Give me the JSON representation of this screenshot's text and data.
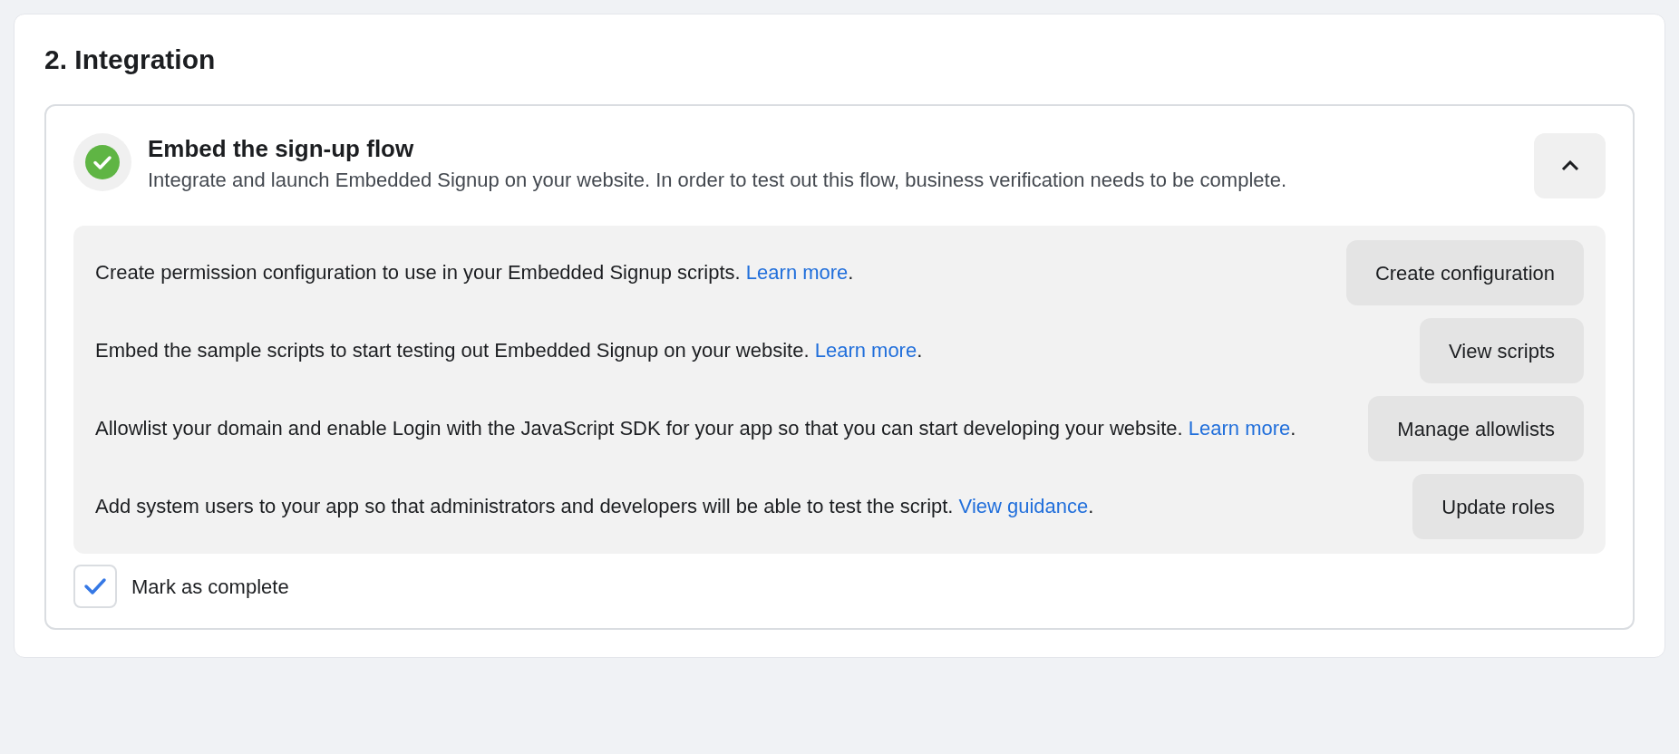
{
  "section": {
    "title": "2. Integration"
  },
  "step": {
    "title": "Embed the sign-up flow",
    "description": "Integrate and launch Embedded Signup on your website. In order to test out this flow, business verification needs to be complete.",
    "completed": true,
    "expanded": true,
    "tasks": [
      {
        "text": "Create permission configuration to use in your Embedded Signup scripts.",
        "link": "Learn more",
        "after": ".",
        "button": "Create configuration"
      },
      {
        "text": "Embed the sample scripts to start testing out Embedded Signup on your website.",
        "link": "Learn more",
        "after": ".",
        "button": "View scripts"
      },
      {
        "text": "Allowlist your domain and enable Login with the JavaScript SDK for your app so that you can start developing your website.",
        "link": "Learn more",
        "after": ".",
        "button": "Manage allowlists"
      },
      {
        "text": "Add system users to your app so that administrators and developers will be able to test the script.",
        "link": "View guidance",
        "after": ".",
        "button": "Update roles"
      }
    ],
    "mark_complete": {
      "label": "Mark as complete",
      "checked": true
    }
  }
}
